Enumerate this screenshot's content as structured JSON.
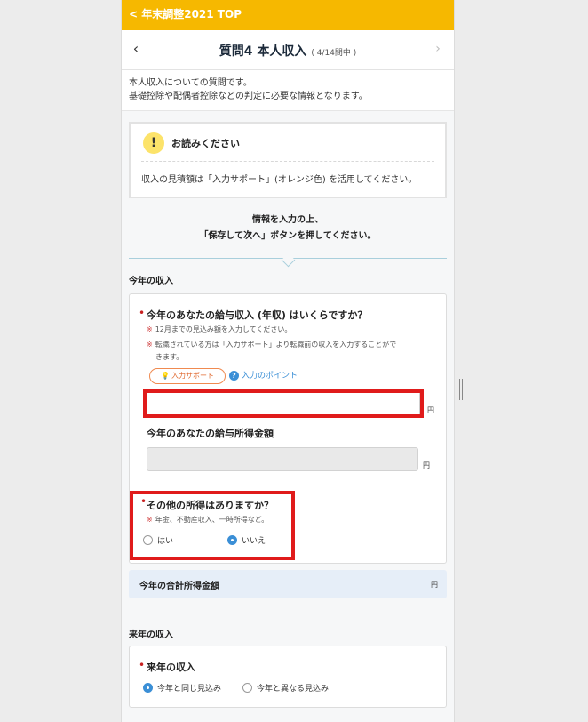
{
  "top_link": "< 年末調整2021 TOP",
  "nav": {
    "back_icon": "‹",
    "title": "質問4 本人収入",
    "progress": "( 4/14問中 )",
    "next_icon": "›"
  },
  "intro": {
    "line1": "本人収入についての質問です。",
    "line2": "基礎控除や配偶者控除などの判定に必要な情報となります。"
  },
  "notice": {
    "icon": "!",
    "heading": "お読みください",
    "body": "収入の見積額は「入力サポート」(オレンジ色) を活用してください。"
  },
  "instruction": {
    "line1": "情報を入力の上、",
    "line2": "「保存して次へ」ボタンを押してください。"
  },
  "this_year": {
    "section_title": "今年の収入",
    "required_mark": "•",
    "q1": {
      "label": "今年のあなたの給与収入 (年収) はいくらですか？",
      "note_mark": "※",
      "note1": "12月までの見込み額を入力してください。",
      "note2a": "転職されている方は「入力サポート」より転職前の収入を入力することがで",
      "note2b": "きます。",
      "support_icon": "💡",
      "support_label": "入力サポート",
      "point_icon": "?",
      "point_label": "入力のポイント",
      "value": "",
      "unit": "円"
    },
    "q1b": {
      "label": "今年のあなたの給与所得金額",
      "unit": "円"
    },
    "q2": {
      "label": "その他の所得はありますか？",
      "note": "年金、不動産収入、一時所得など。",
      "options": [
        {
          "label": "はい",
          "selected": false
        },
        {
          "label": "いいえ",
          "selected": true
        }
      ]
    },
    "total": {
      "label": "今年の合計所得金額",
      "unit": "円"
    }
  },
  "next_year": {
    "section_title": "来年の収入",
    "q": {
      "label": "来年の収入",
      "options": [
        {
          "label": "今年と同じ見込み",
          "selected": true
        },
        {
          "label": "今年と異なる見込み",
          "selected": false
        }
      ]
    }
  },
  "colors": {
    "topbar": "#f6b800",
    "accent_blue": "#3b8fd6",
    "highlight_red": "#e01b1b",
    "support_orange": "#e06a30"
  }
}
